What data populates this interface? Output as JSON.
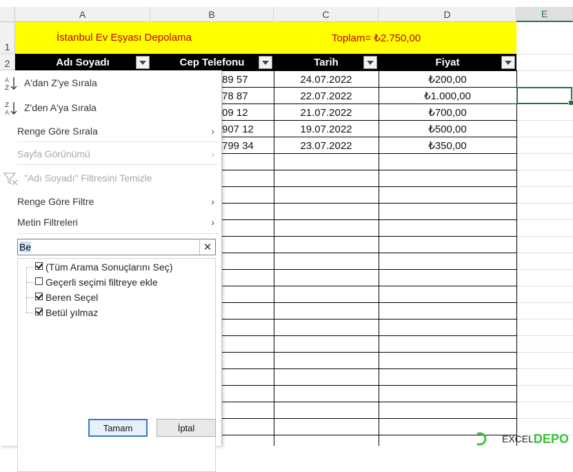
{
  "columns": [
    "A",
    "B",
    "C",
    "D",
    "E"
  ],
  "rows": [
    "1",
    "2"
  ],
  "title_row": {
    "left_text": "İstanbul Ev Eşyası  Depolama",
    "right_text": "Toplam= ₺2.750,00",
    "fill_color": "#ffff00",
    "text_color": "#c00000"
  },
  "headers": [
    "Adı Soyadı",
    "Cep Telefonu",
    "Tarih",
    "Fiyat"
  ],
  "visible_cells": {
    "phone": [
      "89 57",
      "78 87",
      "09 12",
      "907 12",
      "799 34"
    ],
    "date": [
      "24.07.2022",
      "22.07.2022",
      "21.07.2022",
      "19.07.2022",
      "23.07.2022"
    ],
    "price": [
      "₺200,00",
      "₺1.000,00",
      "₺700,00",
      "₺500,00",
      "₺350,00"
    ]
  },
  "menu": {
    "sort_az": "A'dan Z'ye Sırala",
    "sort_za": "Z'den A'ya Sırala",
    "sort_by_color": "Renge Göre Sırala",
    "sheet_view": "Sayfa Görünümü",
    "clear_filter": "\"Adı Soyadı\" Filtresini Temizle",
    "filter_by_color": "Renge Göre Filtre",
    "text_filters": "Metin Filtreleri",
    "arrow": "›"
  },
  "search": {
    "value": "Be",
    "clear": "✕"
  },
  "filter_list": [
    {
      "label": "(Tüm Arama Sonuçlarını Seç)",
      "checked": true
    },
    {
      "label": "Geçerli seçimi filtreye ekle",
      "checked": false
    },
    {
      "label": "Beren Seçel",
      "checked": true
    },
    {
      "label": "Betül yılmaz",
      "checked": true
    }
  ],
  "buttons": {
    "ok": "Tamam",
    "cancel": "İptal"
  },
  "logo": {
    "text_left": "EXCEL",
    "text_right": "DEPO"
  },
  "colors": {
    "accent": "#217346",
    "header_bg": "#000000",
    "logo_green": "#35c23a"
  }
}
